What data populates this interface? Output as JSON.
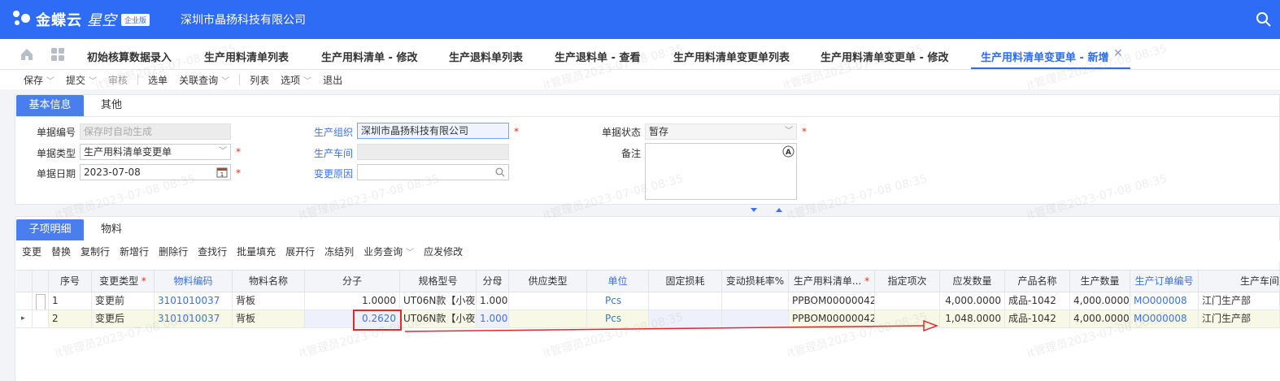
{
  "app": {
    "brand": "金蝶云",
    "product": "星空",
    "edition": "企业版",
    "company": "深圳市晶扬科技有限公司"
  },
  "tabs": [
    {
      "label": "初始核算数据录入"
    },
    {
      "label": "生产用料清单列表"
    },
    {
      "label": "生产用料清单 - 修改"
    },
    {
      "label": "生产退料单列表"
    },
    {
      "label": "生产退料单 - 查看"
    },
    {
      "label": "生产用料清单变更单列表"
    },
    {
      "label": "生产用料清单变更单 - 修改"
    },
    {
      "label": "生产用料清单变更单 - 新增"
    }
  ],
  "toolbar": {
    "save": "保存",
    "submit": "提交",
    "audit": "审核",
    "select": "选单",
    "related": "关联查询",
    "list": "列表",
    "options": "选项",
    "exit": "退出"
  },
  "form": {
    "tab_basic": "基本信息",
    "tab_other": "其他",
    "bill_no_label": "单据编号",
    "bill_no_placeholder": "保存时自动生成",
    "bill_type_label": "单据类型",
    "bill_type_value": "生产用料清单变更单",
    "bill_date_label": "单据日期",
    "bill_date_value": "2023-07-08",
    "prod_org_label": "生产组织",
    "prod_org_value": "深圳市晶扬科技有限公司",
    "workshop_label": "生产车间",
    "workshop_value": "",
    "reason_label": "变更原因",
    "reason_value": "",
    "status_label": "单据状态",
    "status_value": "暂存",
    "remark_label": "备注",
    "remark_value": ""
  },
  "detail": {
    "tab_child": "子项明细",
    "tab_material": "物料",
    "actions": [
      "变更",
      "替换",
      "复制行",
      "新增行",
      "删除行",
      "查找行",
      "批量填充",
      "展开行",
      "冻结列",
      "业务查询",
      "应发修改"
    ],
    "columns": [
      "序号",
      "变更类型",
      "物料编码",
      "物料名称",
      "分子",
      "规格型号",
      "分母",
      "供应类型",
      "单位",
      "固定损耗",
      "变动损耗率%",
      "生产用料清单...",
      "指定项次",
      "应发数量",
      "产品名称",
      "生产数量",
      "生产订单编号",
      "生产车间"
    ],
    "rows": [
      {
        "seq": "1",
        "change_type": "变更前",
        "code": "3101010037",
        "name": "背板",
        "numerator": "1.0000",
        "spec": "UT06N款【小夜",
        "denominator": "1.0000",
        "supply": "",
        "unit": "Pcs",
        "fixed_loss": "",
        "var_loss": "",
        "bom": "PPBOM00000042",
        "item": "",
        "qty": "4,000.0000",
        "product": "成品-1042",
        "prod_qty": "4,000.0000",
        "mo": "MO000008",
        "workshop": "江门生产部"
      },
      {
        "seq": "2",
        "change_type": "变更后",
        "code": "3101010037",
        "name": "背板",
        "numerator": "0.2620",
        "spec": "UT06N款【小夜",
        "denominator": "1.0000",
        "supply": "",
        "unit": "Pcs",
        "fixed_loss": "",
        "var_loss": "",
        "bom": "PPBOM00000042",
        "item": "",
        "qty": "1,048.0000",
        "product": "成品-1042",
        "prod_qty": "4,000.0000",
        "mo": "MO000008",
        "workshop": "江门生产部"
      }
    ]
  },
  "colors": {
    "brand": "#2f6cf5",
    "accent_blue": "#3d72e8",
    "required": "#e0301e",
    "highlight": "#e02a2a"
  },
  "watermark": "it管理员2023-07-08 08:35"
}
